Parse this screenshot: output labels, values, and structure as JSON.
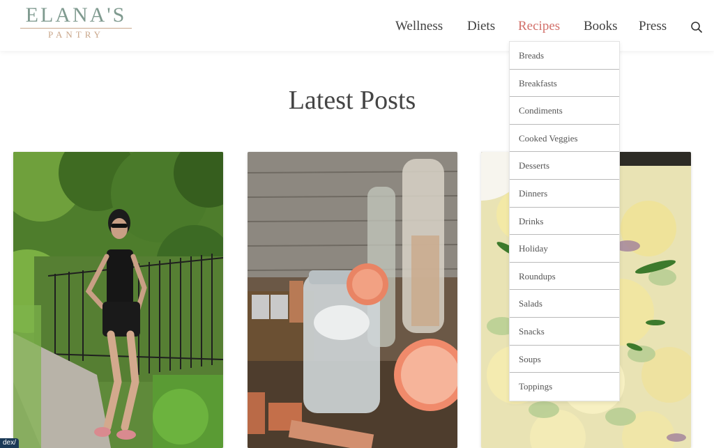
{
  "brand": {
    "name": "ELANA'S",
    "subtitle": "PANTRY",
    "color_primary": "#7f9a8f",
    "color_accent": "#c9a68a"
  },
  "nav": {
    "items": [
      {
        "label": "Wellness"
      },
      {
        "label": "Diets"
      },
      {
        "label": "Recipes",
        "active": true
      },
      {
        "label": "Books"
      },
      {
        "label": "Press"
      }
    ],
    "active_color": "#d2706a",
    "search_icon": "search-icon"
  },
  "dropdown": {
    "items": [
      "Breads",
      "Breakfasts",
      "Condiments",
      "Cooked Veggies",
      "Desserts",
      "Dinners",
      "Drinks",
      "Holiday",
      "Roundups",
      "Salads",
      "Snacks",
      "Soups",
      "Toppings"
    ]
  },
  "main": {
    "heading": "Latest Posts",
    "posts": [
      {
        "image": "woman-outdoors-photo"
      },
      {
        "image": "water-jar-grapefruit-photo"
      },
      {
        "image": "potato-salad-photo"
      }
    ]
  },
  "status": {
    "url_fragment": "dex/"
  }
}
